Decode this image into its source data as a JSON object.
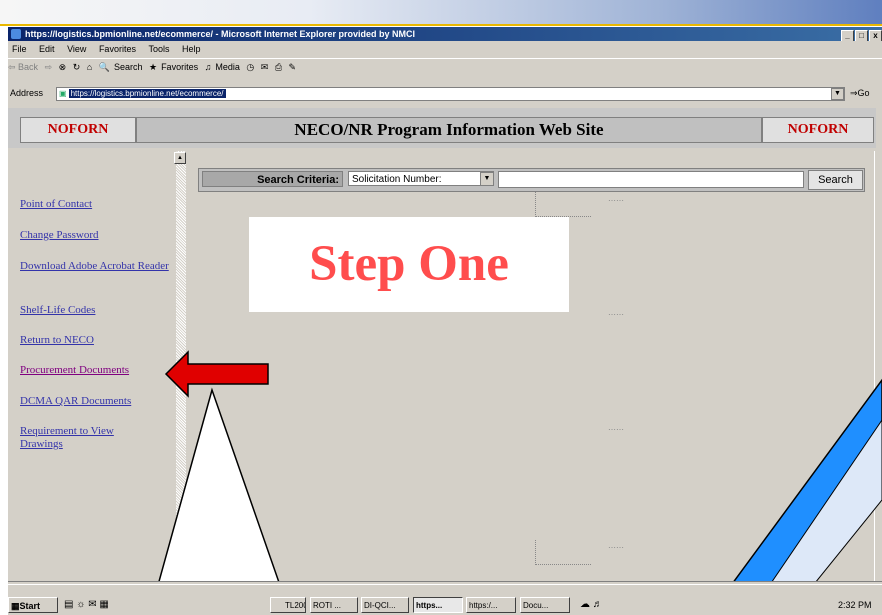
{
  "window": {
    "title": "https://logistics.bpmionline.net/ecommerce/ - Microsoft Internet Explorer provided by NMCI",
    "buttons": [
      "_",
      "□",
      "x"
    ]
  },
  "menu": [
    "File",
    "Edit",
    "View",
    "Favorites",
    "Tools",
    "Help"
  ],
  "toolbar": {
    "back": "⇦ Back",
    "forward": "⇨",
    "search": "Search",
    "favorites": "Favorites",
    "media": "Media"
  },
  "address": {
    "label": "Address",
    "url": "https://logistics.bpmionline.net/ecommerce/",
    "go": "Go"
  },
  "banner": {
    "left": "NOFORN",
    "title": "NECO/NR Program Information Web Site",
    "right": "NOFORN"
  },
  "sidebar": {
    "items": [
      {
        "label": "Point of Contact"
      },
      {
        "label": "Change Password"
      },
      {
        "label": "Download Adobe Acrobat Reader"
      },
      {
        "label": "Shelf-Life Codes"
      },
      {
        "label": "Return to NECO"
      },
      {
        "label": "Procurement Documents"
      },
      {
        "label": "DCMA QAR Documents"
      },
      {
        "label": "Requirement to View Drawings"
      }
    ]
  },
  "search": {
    "label": "Search Criteria:",
    "selected": "Solicitation Number:",
    "button": "Search"
  },
  "overlay": {
    "step": "Step One",
    "arrow_color": "#e00000"
  },
  "taskbar": {
    "start": "Start",
    "items": [
      "TL200...",
      "ROTI ...",
      "DI-QCI...",
      "https...",
      "https:/...",
      "Docu..."
    ],
    "active_index": 3,
    "clock": "2:32 PM"
  },
  "colors": {
    "step_text": "#ff4d4d",
    "noforn": "#c00000",
    "link": "#3333aa",
    "titlebar": "#0a246a"
  }
}
